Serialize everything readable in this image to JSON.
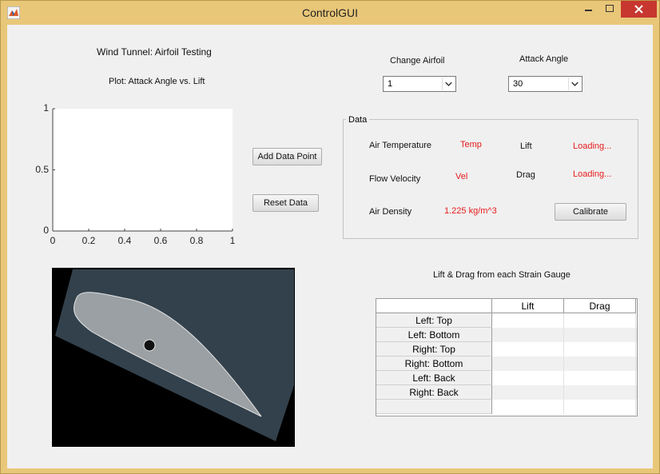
{
  "window": {
    "title": "ControlGUI"
  },
  "header": {
    "main_title": "Wind Tunnel: Airfoil Testing",
    "plot_title": "Plot: Attack Angle vs. Lift"
  },
  "controls": {
    "change_airfoil_label": "Change Airfoil",
    "airfoil_value": "1",
    "attack_angle_label": "Attack Angle",
    "attack_angle_value": "30",
    "add_button": "Add Data Point",
    "reset_button": "Reset Data"
  },
  "data_group": {
    "title": "Data",
    "air_temperature_label": "Air Temperature",
    "air_temperature_value": "Temp",
    "lift_label": "Lift",
    "lift_value": "Loading...",
    "flow_velocity_label": "Flow Velocity",
    "flow_velocity_value": "Vel",
    "drag_label": "Drag",
    "drag_value": "Loading...",
    "air_density_label": "Air Density",
    "air_density_value": "1.225 kg/m^3",
    "calibrate_button": "Calibrate"
  },
  "chart_data": {
    "type": "line",
    "x": [],
    "y": [],
    "xlim": [
      0,
      1
    ],
    "ylim": [
      0,
      1
    ],
    "xticks": [
      "0",
      "0.2",
      "0.4",
      "0.6",
      "0.8",
      "1"
    ],
    "yticks": [
      "0",
      "0.5",
      "1"
    ]
  },
  "table": {
    "title": "Lift & Drag from each Strain Gauge",
    "columns": [
      "Lift",
      "Drag"
    ],
    "rows": [
      "Left: Top",
      "Left: Bottom",
      "Right: Top",
      "Right: Bottom",
      "Left: Back",
      "Right: Back",
      ""
    ]
  },
  "colors": {
    "accent_red": "#e81b1b",
    "titlebar": "#e9c779",
    "close_button": "#c7372f"
  }
}
